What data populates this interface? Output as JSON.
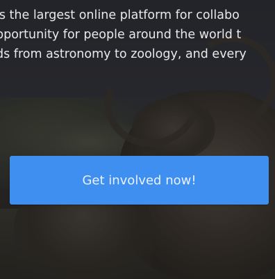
{
  "hero": {
    "intro_lines": [
      "is the largest online platform for collabo",
      "pportunity for people around the world t",
      "ds from astronomy to zoology, and every"
    ],
    "cta_label": "Get involved now!",
    "cta_color": "#3f8ff0"
  }
}
